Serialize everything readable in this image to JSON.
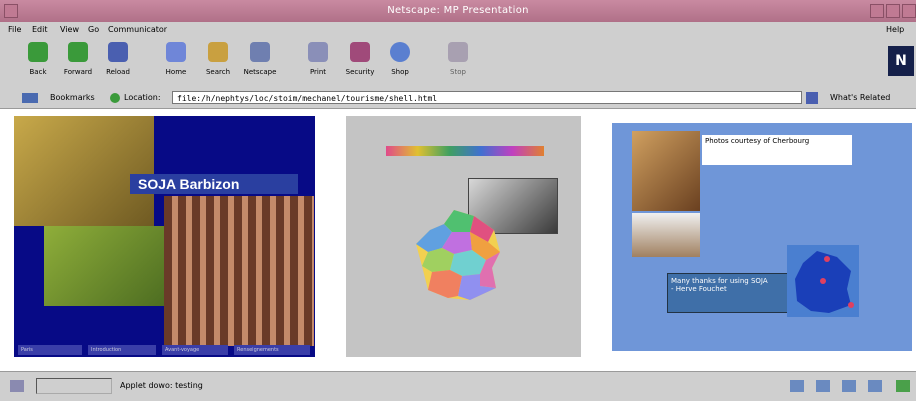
{
  "window": {
    "title": "Netscape: MP Presentation"
  },
  "menu": {
    "items": [
      "File",
      "Edit",
      "View",
      "Go",
      "Communicator"
    ],
    "help": "Help"
  },
  "toolbar": {
    "buttons": [
      {
        "label": "Back",
        "icon": "back-arrow-icon"
      },
      {
        "label": "Forward",
        "icon": "forward-arrow-icon"
      },
      {
        "label": "Reload",
        "icon": "reload-icon"
      },
      {
        "label": "Home",
        "icon": "home-icon"
      },
      {
        "label": "Search",
        "icon": "search-icon"
      },
      {
        "label": "Netscape",
        "icon": "netscape-icon"
      },
      {
        "label": "Print",
        "icon": "print-icon"
      },
      {
        "label": "Security",
        "icon": "security-lock-icon"
      },
      {
        "label": "Shop",
        "icon": "shop-icon"
      },
      {
        "label": "Stop",
        "icon": "stop-icon"
      }
    ],
    "logo": "N"
  },
  "location": {
    "bookmarks_label": "Bookmarks",
    "location_label": "Location:",
    "url": "file:/h/nephtys/loc/stoim/mechanel/tourisme/shell.html",
    "whats_related": "What's Related"
  },
  "slides": {
    "left": {
      "title": "SOJA Barbizon",
      "tabs": [
        "Paris",
        "Introduction",
        "Avant-voyage",
        "Renseignements"
      ]
    },
    "right": {
      "credit": "Photos courtesy of Cherbourg",
      "thanks": "Many thanks for using SOJA\n- Herve Fouchet"
    }
  },
  "status": {
    "text": "Applet dowo: testing"
  },
  "colors": {
    "titlebar": "#c98aa1",
    "chrome": "#cfcfcf",
    "slide_blue": "#070a86",
    "slide_sky": "#6f96d8"
  }
}
